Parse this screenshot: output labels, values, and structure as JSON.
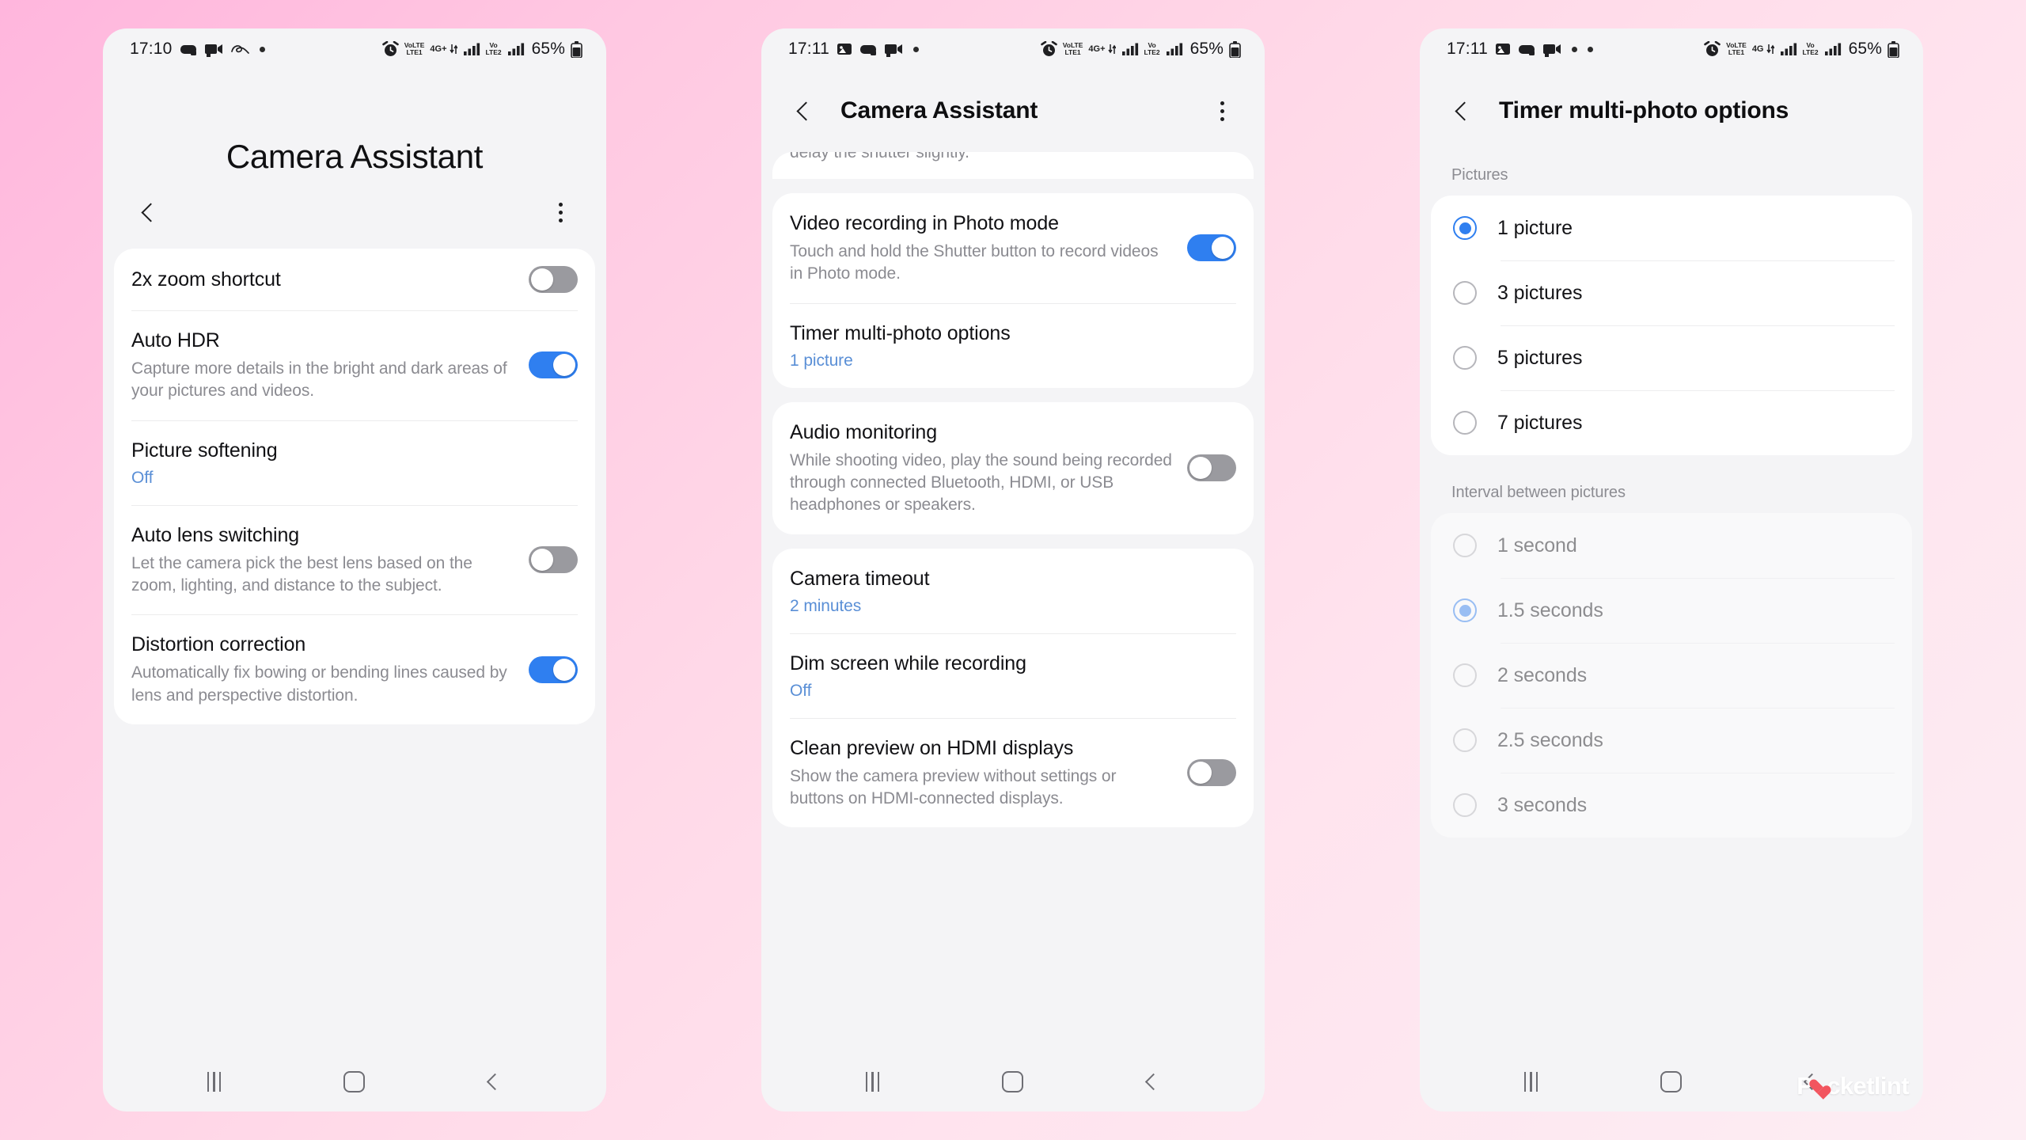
{
  "theme": {
    "accent_blue": "#2f7ff0",
    "value_blue": "#5a8fd6",
    "toggle_off_gray": "#9a9a9f",
    "card_white": "#ffffff",
    "screen_bg": "#f4f4f6",
    "background_pink": "#ffc9e2"
  },
  "watermark": {
    "text_pre": "P",
    "text_post": "cketlint"
  },
  "panel1": {
    "status": {
      "time": "17:10",
      "left_icons": [
        "game-controller-icon",
        "camera-video-icon",
        "scribble-icon",
        "dot-icon"
      ],
      "right_icons": [
        "alarm-icon",
        "volte1-icon",
        "4g-plus-icon",
        "signal-bars-icon",
        "volte2-icon",
        "signal-bars-icon",
        "battery-icon"
      ],
      "volte1_top": "VoLTE",
      "volte1_bottom": "LTE1",
      "net_label": "4G+",
      "volte2_top": "Vo",
      "volte2_bottom": "LTE2",
      "battery": "65%"
    },
    "big_title": "Camera Assistant",
    "actions": {
      "back": "back-icon",
      "more": "more-options-icon"
    },
    "items": [
      {
        "title": "2x zoom shortcut",
        "desc": "",
        "toggle": "off"
      },
      {
        "title": "Auto HDR",
        "desc": "Capture more details in the bright and dark areas of your pictures and videos.",
        "toggle": "on"
      },
      {
        "title": "Picture softening",
        "value": "Off"
      },
      {
        "title": "Auto lens switching",
        "desc": "Let the camera pick the best lens based on the zoom, lighting, and distance to the subject.",
        "toggle": "off"
      },
      {
        "title": "Distortion correction",
        "desc": "Automatically fix bowing or bending lines caused by lens and perspective distortion.",
        "toggle": "on"
      }
    ],
    "nav": {
      "recents": "recents-icon",
      "home": "home-icon",
      "back": "back-icon"
    }
  },
  "panel2": {
    "status": {
      "time": "17:11",
      "volte1_top": "VoLTE",
      "volte1_bottom": "LTE1",
      "net_label": "4G+",
      "volte2_top": "Vo",
      "volte2_bottom": "LTE2",
      "battery": "65%"
    },
    "appbar": {
      "title": "Camera Assistant",
      "back": "back-icon",
      "more": "more-options-icon"
    },
    "peek_text": "delay the shutter slightly.",
    "group1": [
      {
        "title": "Video recording in Photo mode",
        "desc": "Touch and hold the Shutter button to record videos in Photo mode.",
        "toggle": "on"
      },
      {
        "title": "Timer multi-photo options",
        "value": "1 picture"
      }
    ],
    "group2": [
      {
        "title": "Audio monitoring",
        "desc": "While shooting video, play the sound being recorded through connected Bluetooth, HDMI, or USB headphones or speakers.",
        "toggle": "off"
      }
    ],
    "group3": [
      {
        "title": "Camera timeout",
        "value": "2 minutes"
      },
      {
        "title": "Dim screen while recording",
        "value": "Off"
      },
      {
        "title": "Clean preview on HDMI displays",
        "desc": "Show the camera preview without settings or buttons on HDMI-connected displays.",
        "toggle": "off"
      }
    ],
    "nav": {
      "recents": "recents-icon",
      "home": "home-icon",
      "back": "back-icon"
    }
  },
  "panel3": {
    "status": {
      "time": "17:11",
      "volte1_top": "VoLTE",
      "volte1_bottom": "LTE1",
      "net_label": "4G",
      "volte2_top": "Vo",
      "volte2_bottom": "LTE2",
      "battery": "65%"
    },
    "appbar": {
      "title": "Timer multi-photo options",
      "back": "back-icon"
    },
    "pictures_label": "Pictures",
    "pictures_options": [
      {
        "label": "1 picture",
        "selected": true
      },
      {
        "label": "3 pictures",
        "selected": false
      },
      {
        "label": "5 pictures",
        "selected": false
      },
      {
        "label": "7 pictures",
        "selected": false
      }
    ],
    "interval_label": "Interval between pictures",
    "interval_disabled": true,
    "interval_options": [
      {
        "label": "1 second",
        "selected": false
      },
      {
        "label": "1.5 seconds",
        "selected": true
      },
      {
        "label": "2 seconds",
        "selected": false
      },
      {
        "label": "2.5 seconds",
        "selected": false
      },
      {
        "label": "3 seconds",
        "selected": false
      }
    ],
    "nav": {
      "recents": "recents-icon",
      "home": "home-icon",
      "back": "back-icon"
    }
  }
}
